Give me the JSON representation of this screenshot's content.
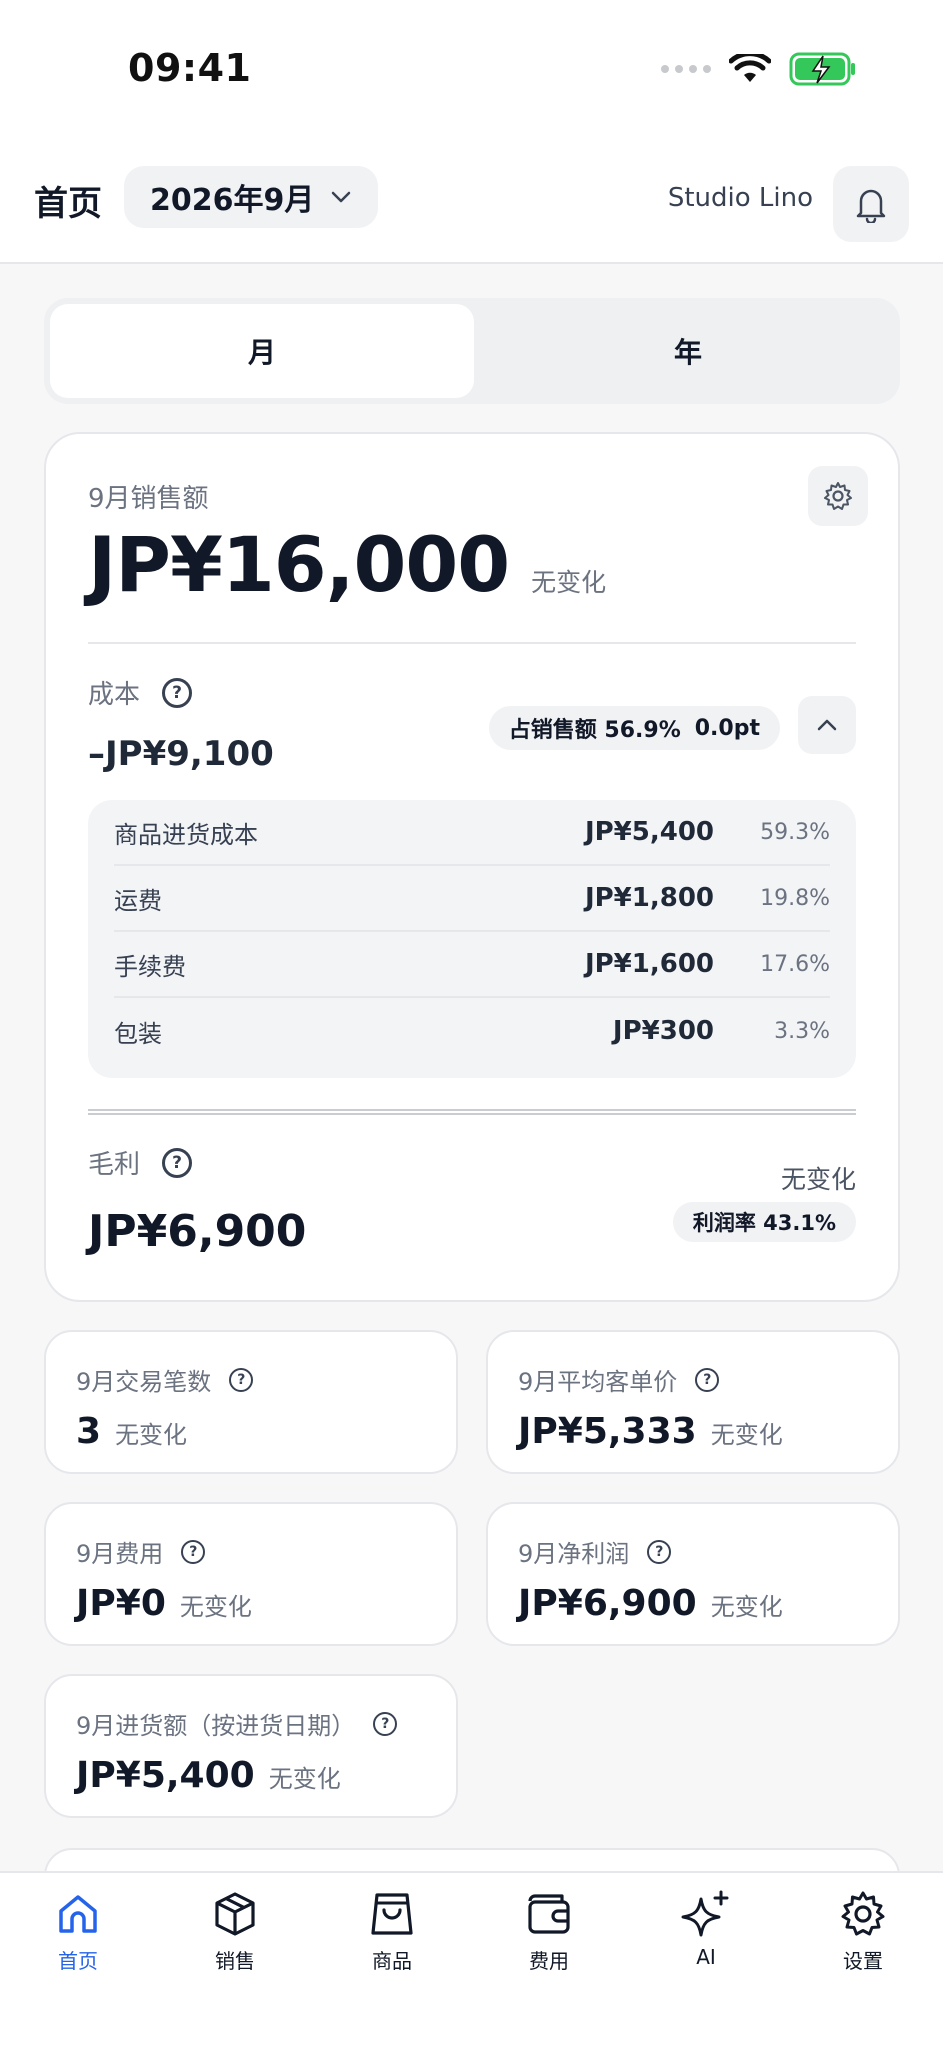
{
  "status_bar": {
    "time": "09:41"
  },
  "header": {
    "title": "首页",
    "month_picker": "2026年9月",
    "studio": "Studio Lino"
  },
  "period_tabs": [
    "月",
    "年"
  ],
  "sales": {
    "label": "9月销售额",
    "value": "JP¥16,000",
    "change": "无变化"
  },
  "cost": {
    "label": "成本",
    "value": "–JP¥9,100",
    "share_label": "占销售额 56.9%",
    "share_change": "0.0pt",
    "breakdown": [
      {
        "name": "商品进货成本",
        "amount": "JP¥5,400",
        "pct": "59.3%"
      },
      {
        "name": "运费",
        "amount": "JP¥1,800",
        "pct": "19.8%"
      },
      {
        "name": "手续费",
        "amount": "JP¥1,600",
        "pct": "17.6%"
      },
      {
        "name": "包装",
        "amount": "JP¥300",
        "pct": "3.3%"
      }
    ]
  },
  "gross_profit": {
    "label": "毛利",
    "value": "JP¥6,900",
    "change": "无变化",
    "margin": "利润率 43.1%"
  },
  "metrics": [
    {
      "label": "9月交易笔数",
      "value": "3",
      "change": "无变化"
    },
    {
      "label": "9月平均客单价",
      "value": "JP¥5,333",
      "change": "无变化"
    },
    {
      "label": "9月费用",
      "value": "JP¥0",
      "change": "无变化"
    },
    {
      "label": "9月净利润",
      "value": "JP¥6,900",
      "change": "无变化"
    },
    {
      "label": "9月进货额（按进货日期）",
      "value": "JP¥5,400",
      "change": "无变化"
    }
  ],
  "tabbar": [
    {
      "label": "首页",
      "icon": "home-icon",
      "active": true
    },
    {
      "label": "销售",
      "icon": "box-icon"
    },
    {
      "label": "商品",
      "icon": "shopping-bag-icon"
    },
    {
      "label": "费用",
      "icon": "wallet-icon"
    },
    {
      "label": "AI",
      "icon": "sparkle-icon"
    },
    {
      "label": "设置",
      "icon": "gear-icon"
    }
  ],
  "colors": {
    "accent": "#2563eb",
    "battery": "#34c759"
  }
}
